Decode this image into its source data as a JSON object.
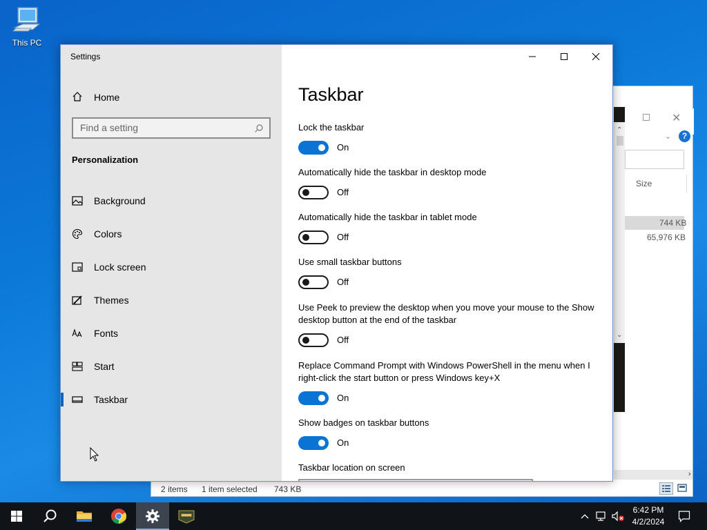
{
  "desktop": {
    "icon_label": "This PC"
  },
  "explorer": {
    "column_size": "Size",
    "row_sizes": [
      "744 KB",
      "65,976 KB"
    ],
    "status_items": "2 items",
    "status_selected": "1 item selected",
    "status_selected_size": "743 KB",
    "help_icon": "?"
  },
  "settings": {
    "window_title": "Settings",
    "nav": {
      "home_label": "Home",
      "search_placeholder": "Find a setting",
      "section_title": "Personalization",
      "items": [
        {
          "label": "Background",
          "icon": "picture-icon"
        },
        {
          "label": "Colors",
          "icon": "palette-icon"
        },
        {
          "label": "Lock screen",
          "icon": "lock-screen-icon"
        },
        {
          "label": "Themes",
          "icon": "brush-icon"
        },
        {
          "label": "Fonts",
          "icon": "font-icon"
        },
        {
          "label": "Start",
          "icon": "start-icon"
        },
        {
          "label": "Taskbar",
          "icon": "taskbar-icon",
          "active": true
        }
      ]
    },
    "page_title": "Taskbar",
    "options": [
      {
        "label": "Lock the taskbar",
        "state": "On"
      },
      {
        "label": "Automatically hide the taskbar in desktop mode",
        "state": "Off"
      },
      {
        "label": "Automatically hide the taskbar in tablet mode",
        "state": "Off"
      },
      {
        "label": "Use small taskbar buttons",
        "state": "Off"
      },
      {
        "label": "Use Peek to preview the desktop when you move your mouse to the Show desktop button at the end of the taskbar",
        "state": "Off"
      },
      {
        "label": "Replace Command Prompt with Windows PowerShell in the menu when I right-click the start button or press Windows key+X",
        "state": "On"
      },
      {
        "label": "Show badges on taskbar buttons",
        "state": "On"
      }
    ],
    "location_label": "Taskbar location on screen"
  },
  "taskbar": {
    "apps": [
      "start-icon",
      "search-icon",
      "file-explorer-icon",
      "chrome-icon",
      "settings-icon",
      "game-icon"
    ],
    "time": "6:42 PM",
    "date": "4/2/2024"
  },
  "colors": {
    "accent": "#0a74d4",
    "desktop": "#0b78d8",
    "taskbar": "#101419"
  }
}
